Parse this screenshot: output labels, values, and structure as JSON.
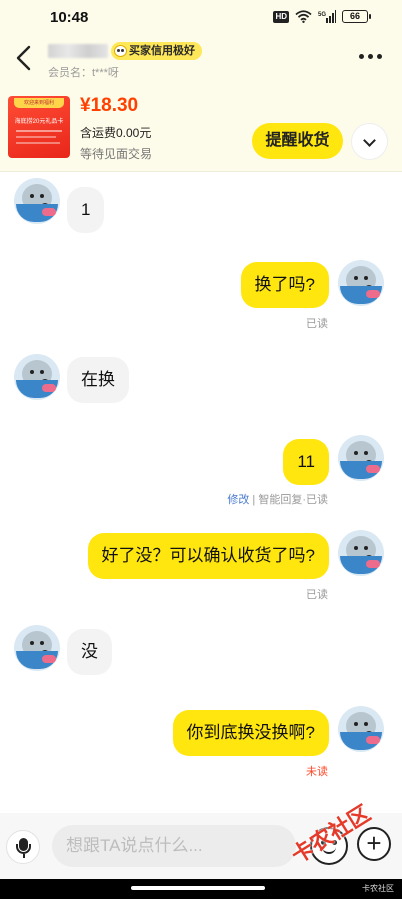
{
  "status_bar": {
    "time": "10:48",
    "hd": "HD",
    "signal": "5G",
    "battery": "66"
  },
  "header": {
    "credit_badge": "买家信用极好",
    "member": "会员名：t***呀"
  },
  "order": {
    "thumb_banner": "欢迎来到福利",
    "thumb_title": "海底捞20元礼品卡",
    "price": "¥18.30",
    "shipping": "含运费0.00元",
    "status": "等待见面交易",
    "remind_label": "提醒收货"
  },
  "messages": [
    {
      "side": "in",
      "text": "1"
    },
    {
      "side": "out",
      "text": "换了吗?",
      "status": "已读"
    },
    {
      "side": "in",
      "text": "在换"
    },
    {
      "side": "out",
      "text": "11",
      "edit": "修改",
      "status": "| 智能回复·已读"
    },
    {
      "side": "out",
      "text": "好了没？可以确认收货了吗?",
      "status": "已读"
    },
    {
      "side": "in",
      "text": "没"
    },
    {
      "side": "out",
      "text": "你到底换没换啊?",
      "status": "未读"
    }
  ],
  "input_bar": {
    "placeholder": "想跟TA说点什么...",
    "watermark": "卡农社区"
  },
  "nav_bar": {
    "watermark": "卡农社区"
  },
  "icons": [
    "back-arrow-icon",
    "wifi-icon",
    "signal-icon",
    "battery-icon",
    "more-icon",
    "chevron-down-icon",
    "mic-icon",
    "emoji-icon",
    "plus-icon"
  ],
  "colors": {
    "accent_yellow": "#ffe60f",
    "price_red": "#ff4000",
    "unread_red": "#ff4a2a",
    "edit_blue": "#4a7bd0"
  }
}
